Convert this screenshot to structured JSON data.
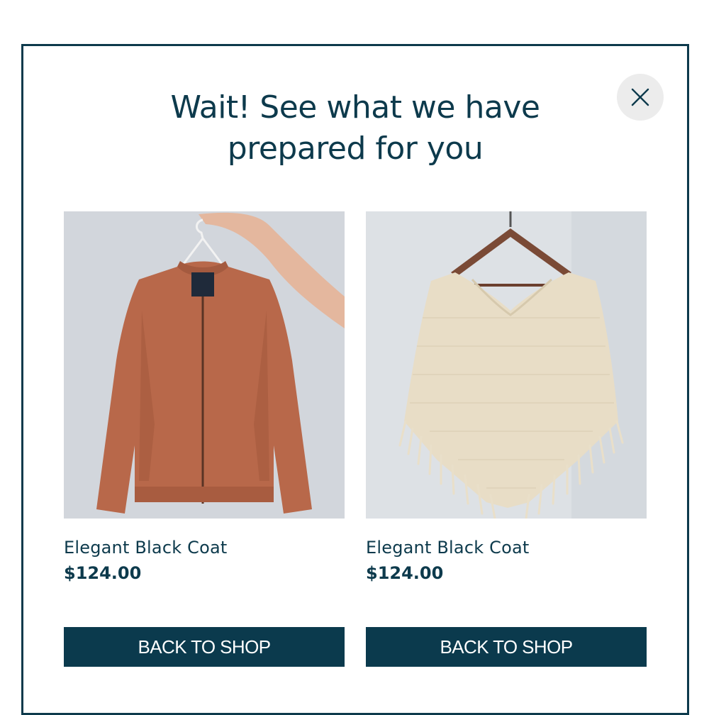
{
  "modal": {
    "title_line1": "Wait! See what we have",
    "title_line2": "prepared for you",
    "close_icon": "close-icon"
  },
  "products": [
    {
      "name": "Elegant Black Coat",
      "price": "$124.00",
      "button_label": "BACK TO SHOP",
      "image_subject": "rust bomber jacket on hanger",
      "image_color": "#b8684a"
    },
    {
      "name": "Elegant Black Coat",
      "price": "$124.00",
      "button_label": "BACK TO SHOP",
      "image_subject": "cream knit fringed poncho on hanger",
      "image_color": "#e8ddc6"
    }
  ],
  "colors": {
    "accent": "#0b3a4d",
    "close_bg": "#ececec",
    "border": "#0d3a4c"
  }
}
